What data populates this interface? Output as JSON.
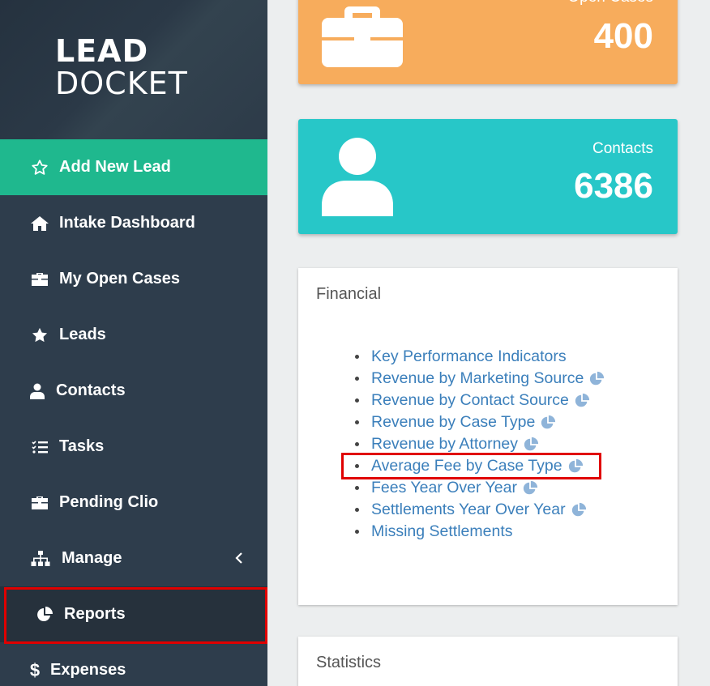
{
  "logo": {
    "line1": "LEAD",
    "line2": "DOCKET"
  },
  "sidebar": {
    "items": [
      {
        "label": "Add New Lead",
        "icon": "star-outline-icon"
      },
      {
        "label": "Intake Dashboard",
        "icon": "home-icon"
      },
      {
        "label": "My Open Cases",
        "icon": "briefcase-icon"
      },
      {
        "label": "Leads",
        "icon": "star-icon"
      },
      {
        "label": "Contacts",
        "icon": "user-icon"
      },
      {
        "label": "Tasks",
        "icon": "tasks-list-icon"
      },
      {
        "label": "Pending Clio",
        "icon": "briefcase-icon"
      },
      {
        "label": "Manage",
        "icon": "sitemap-icon"
      },
      {
        "label": "Reports",
        "icon": "pie-chart-icon"
      },
      {
        "label": "Expenses",
        "icon": "dollar-icon"
      }
    ]
  },
  "stats": {
    "open_cases": {
      "label": "Open Cases",
      "value": "400"
    },
    "contacts": {
      "label": "Contacts",
      "value": "6386"
    }
  },
  "financial": {
    "title": "Financial",
    "reports": [
      {
        "label": "Key Performance Indicators",
        "has_chart": false
      },
      {
        "label": "Revenue by Marketing Source",
        "has_chart": true
      },
      {
        "label": "Revenue by Contact Source",
        "has_chart": true
      },
      {
        "label": "Revenue by Case Type",
        "has_chart": true
      },
      {
        "label": "Revenue by Attorney",
        "has_chart": true
      },
      {
        "label": "Average Fee by Case Type",
        "has_chart": true
      },
      {
        "label": "Fees Year Over Year",
        "has_chart": true
      },
      {
        "label": "Settlements Year Over Year",
        "has_chart": true
      },
      {
        "label": "Missing Settlements",
        "has_chart": false
      }
    ]
  },
  "statistics": {
    "title": "Statistics"
  },
  "colors": {
    "sidebar_bg": "#2e3d4c",
    "active_green": "#1fb88e",
    "orange_card": "#f7ac5c",
    "teal_card": "#27c7c8",
    "link_blue": "#3b7fbb",
    "highlight_red": "#e00000"
  }
}
